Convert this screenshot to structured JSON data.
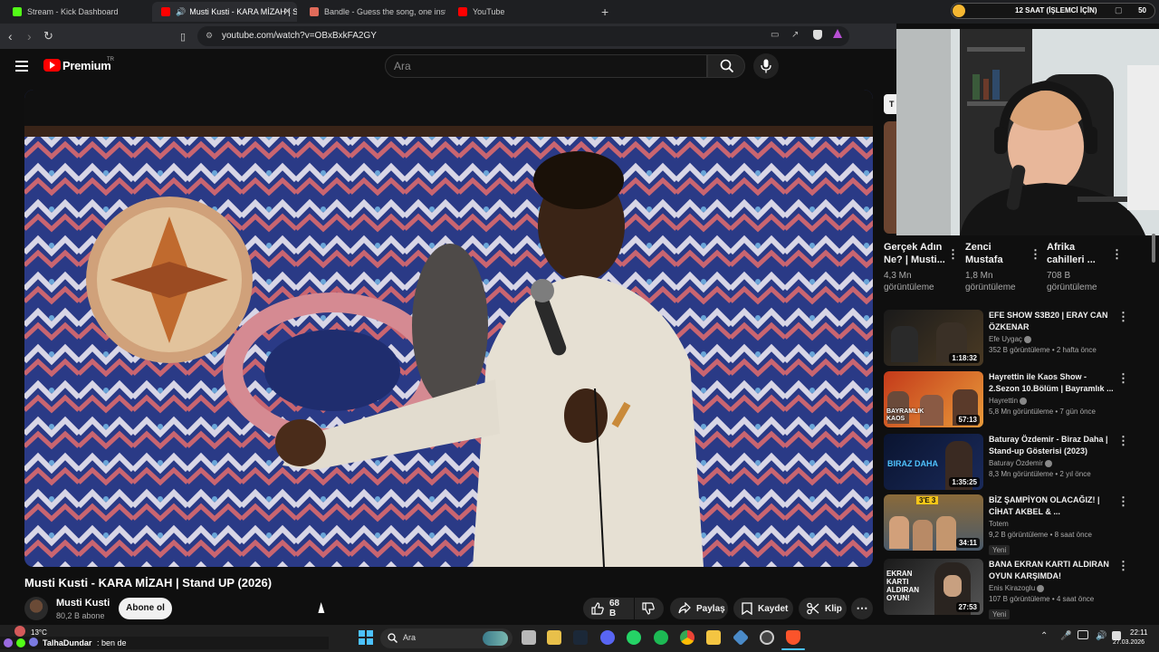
{
  "browser": {
    "tabs": [
      {
        "label": "Stream - Kick Dashboard",
        "active": false
      },
      {
        "label": "Musti Kusti - KARA MİZAH | S",
        "active": true
      },
      {
        "label": "Bandle - Guess the song, one instrum",
        "active": false
      },
      {
        "label": "YouTube",
        "active": false
      }
    ],
    "url": "youtube.com/watch?v=OBxBxkFA2GY"
  },
  "stream_overlay": {
    "text": "12 SAAT (İŞLEMCİ İÇİN)",
    "count": "50"
  },
  "youtube": {
    "logo": "Premium",
    "logo_region": "TR",
    "search_placeholder": "Ara",
    "video": {
      "title": "Musti Kusti - KARA MİZAH  | Stand UP (2026)",
      "channel": "Musti Kusti",
      "subscribers": "80,2 B abone",
      "subscribe_label": "Abone ol",
      "likes": "68 B",
      "share_label": "Paylaş",
      "save_label": "Kaydet",
      "clip_label": "Klip"
    },
    "top_cards": [
      {
        "title1": "Gerçek Adın",
        "title2": "Ne? | Musti...",
        "views1": "4,3 Mn",
        "views2": "görüntüleme"
      },
      {
        "title1": "Zenci",
        "title2": "Mustafa",
        "views1": "1,8 Mn",
        "views2": "görüntüleme"
      },
      {
        "title1": "Afrika",
        "title2": "cahilleri ...",
        "views1": "708 B",
        "views2": "görüntüleme"
      }
    ],
    "recommendations": [
      {
        "title": "EFE SHOW S3B20 | ERAY CAN ÖZKENAR",
        "channel": "Efe Uygaç",
        "meta": "352 B görüntüleme • 2 hafta önce",
        "duration": "1:18:32",
        "new": ""
      },
      {
        "title": "Hayrettin ile Kaos Show - 2.Sezon 10.Bölüm | Bayramlık ...",
        "channel": "Hayrettin",
        "meta": "5,8 Mn görüntüleme • 7 gün önce",
        "duration": "57:13",
        "new": ""
      },
      {
        "title": "Baturay Özdemir - Biraz Daha | Stand-up Gösterisi (2023)",
        "channel": "Baturay Özdemir",
        "meta": "8,3 Mn görüntüleme • 2 yıl önce",
        "duration": "1:35:25",
        "new": ""
      },
      {
        "title": "BİZ ŞAMPİYON OLACAĞIZ! | CİHAT AKBEL & ...",
        "channel": "Totem",
        "meta": "9,2 B görüntüleme • 8 saat önce",
        "duration": "34:11",
        "new": "Yeni"
      },
      {
        "title": "BANA EKRAN KARTI ALDIRAN OYUN KARŞIMDA!",
        "channel": "Enis Kirazoglu",
        "meta": "107 B görüntüleme • 4 saat önce",
        "duration": "27:53",
        "new": "Yeni"
      }
    ],
    "thumb_texts": [
      "BAYRAMLIK KAOS",
      "BIRAZ DAHA",
      "3'E 3",
      "EKRAN KARTI ALDIRAN OYUN!"
    ]
  },
  "taskbar": {
    "weather": "13°C",
    "chat_user": "TalhaDundar",
    "chat_msg": ": ben de",
    "search": "Ara",
    "time": "22:11",
    "date": "27.03.2026"
  },
  "colors": {
    "yt_red": "#ff0000",
    "background": "#0f0f0f",
    "kick_green": "#53fc18"
  }
}
